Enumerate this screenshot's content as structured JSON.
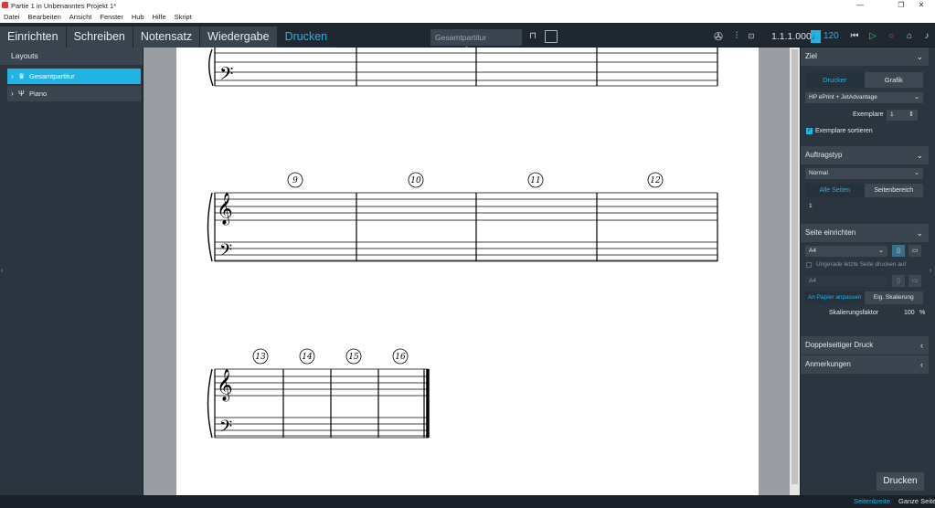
{
  "window": {
    "title": "Partie 1 in Unbenanntes Projekt 1*",
    "controls": [
      "—",
      "❐",
      "✕"
    ]
  },
  "menu": [
    "Datei",
    "Bearbeiten",
    "Ansicht",
    "Fenster",
    "Hub",
    "Hilfe",
    "Skript"
  ],
  "modes": [
    "Einrichten",
    "Schreiben",
    "Notensatz",
    "Wiedergabe",
    "Drucken"
  ],
  "active_mode": "Drucken",
  "toolbar": {
    "layout_name": "Gesamtpartitur",
    "position": "1.1.1.000",
    "tempo": "120",
    "tempo_note_icon": "quarter-note-icon"
  },
  "left_panel": {
    "header": "Layouts",
    "items": [
      {
        "label": "Gesamtpartitur",
        "icon": "full-score-icon",
        "selected": true
      },
      {
        "label": "Piano",
        "icon": "piano-icon",
        "selected": false
      }
    ]
  },
  "score": {
    "bar_numbers_system2": [
      "9",
      "10",
      "11",
      "12"
    ],
    "bar_numbers_system3": [
      "13",
      "14",
      "15",
      "16"
    ]
  },
  "right_panel": {
    "ziel": {
      "title": "Ziel",
      "tabs": [
        "Drucker",
        "Grafik"
      ],
      "printer": "HP ePrint + JetAdvantage",
      "copies_label": "Exemplare",
      "copies_value": "1",
      "collate_label": "Exemplare sortieren"
    },
    "auftragstyp": {
      "title": "Auftragstyp",
      "type": "Normal",
      "tabs": [
        "Alle Seiten",
        "Seitenbereich"
      ],
      "range": "1"
    },
    "seite": {
      "title": "Seite einrichten",
      "paper": "A4",
      "odd_page_label": "Ungerade letzte Seite drucken auf",
      "paper2": "A4",
      "scale_tabs": [
        "An Papier anpassen",
        "Eig. Skalierung"
      ],
      "scale_label": "Skalierungsfaktor",
      "scale_value": "100",
      "scale_unit": "%"
    },
    "doppelseitig": {
      "title": "Doppelseitiger Druck"
    },
    "anmerkungen": {
      "title": "Anmerkungen"
    },
    "print_button": "Drucken"
  },
  "statusbar": {
    "fit_width": "Seitenbreite",
    "fit_page": "Ganze Seite"
  },
  "colors": {
    "accent": "#21b3e4",
    "panel": "#2b3540",
    "page": "#ffffff"
  }
}
